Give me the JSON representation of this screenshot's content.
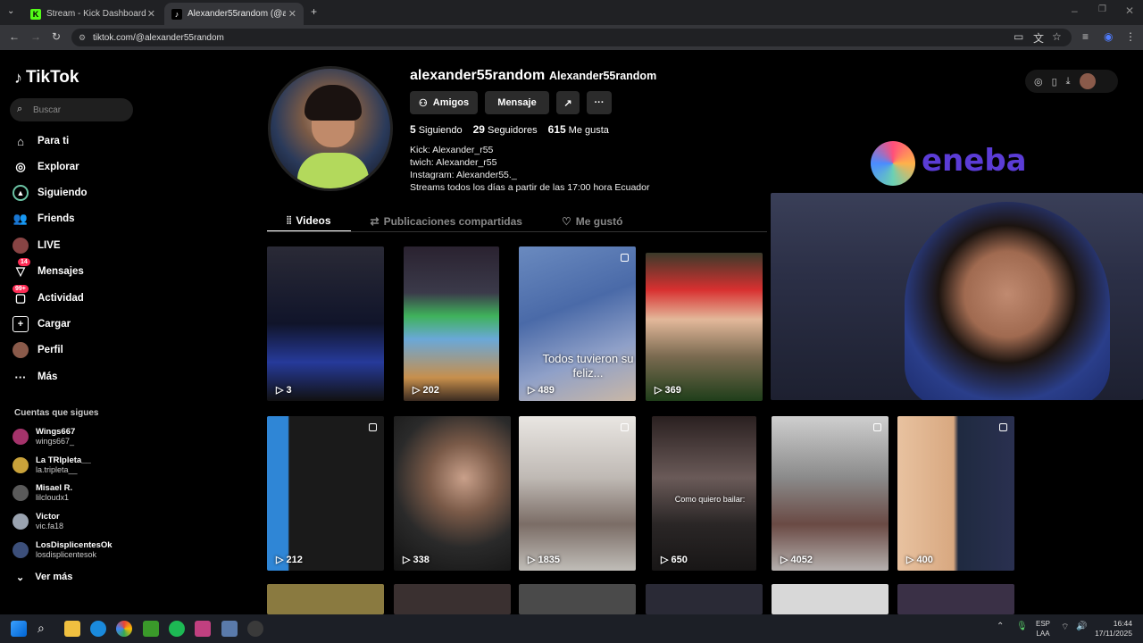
{
  "browser": {
    "tabs": [
      {
        "title": "Stream - Kick Dashboard",
        "icon": "kick-icon",
        "active": false
      },
      {
        "title": "Alexander55random (@alexander55random) | TikTok",
        "icon": "tiktok-icon",
        "active": true
      }
    ],
    "new_tab": "+",
    "url": "tiktok.com/@alexander55random"
  },
  "sidebar": {
    "brand": "TikTok",
    "search_placeholder": "Buscar",
    "nav": [
      {
        "label": "Para ti",
        "icon": "home-icon"
      },
      {
        "label": "Explorar",
        "icon": "compass-icon"
      },
      {
        "label": "Siguiendo",
        "icon": "following-icon"
      },
      {
        "label": "Friends",
        "icon": "friends-icon"
      },
      {
        "label": "LIVE",
        "icon": "live-icon"
      },
      {
        "label": "Mensajes",
        "icon": "messages-icon",
        "badge": "14"
      },
      {
        "label": "Actividad",
        "icon": "activity-icon",
        "badge": "99+"
      },
      {
        "label": "Cargar",
        "icon": "upload-icon"
      },
      {
        "label": "Perfil",
        "icon": "profile-icon"
      },
      {
        "label": "Más",
        "icon": "more-icon"
      }
    ],
    "following_title": "Cuentas que sigues",
    "following": [
      {
        "name": "Wings667",
        "handle": "wings667_"
      },
      {
        "name": "La TRIpleta__",
        "handle": "la.tripleta__"
      },
      {
        "name": "Misael R.",
        "handle": "lilcloudx1"
      },
      {
        "name": "Victor",
        "handle": "vic.fa18"
      },
      {
        "name": "LosDisplicentesOk",
        "handle": "losdisplicentesok"
      }
    ],
    "see_more": "Ver más"
  },
  "profile": {
    "username": "alexander55random",
    "nickname": "Alexander55random",
    "buttons": {
      "friends": "Amigos",
      "message": "Mensaje"
    },
    "stats": {
      "following": "5",
      "following_label": "Siguiendo",
      "followers": "29",
      "followers_label": "Seguidores",
      "likes": "615",
      "likes_label": "Me gusta"
    },
    "bio": [
      "Kick: Alexander_r55",
      "twich: Alexander_r55",
      "Instagram: Alexander55._",
      "Streams todos los días a partir de las 17:00 hora Ecuador"
    ],
    "tabs": [
      {
        "label": "Videos",
        "active": true
      },
      {
        "label": "Publicaciones compartidas",
        "active": false
      },
      {
        "label": "Me gustó",
        "active": false
      }
    ]
  },
  "videos": [
    {
      "views": "3"
    },
    {
      "views": "202"
    },
    {
      "views": "489",
      "caption": "Todos tuvieron su feliz..."
    },
    {
      "views": "369"
    },
    {
      "views": "212"
    },
    {
      "views": "338"
    },
    {
      "views": "1835"
    },
    {
      "views": "650",
      "caption": "Como quiero bailar:"
    },
    {
      "views": "4052"
    },
    {
      "views": "400"
    }
  ],
  "overlay": {
    "sponsor": "eneba"
  },
  "taskbar": {
    "lang_top": "ESP",
    "lang_bottom": "LAA",
    "time": "16:44",
    "date": "17/11/2025"
  },
  "colors": {
    "accent": "#fe2c55",
    "background": "#000000"
  }
}
